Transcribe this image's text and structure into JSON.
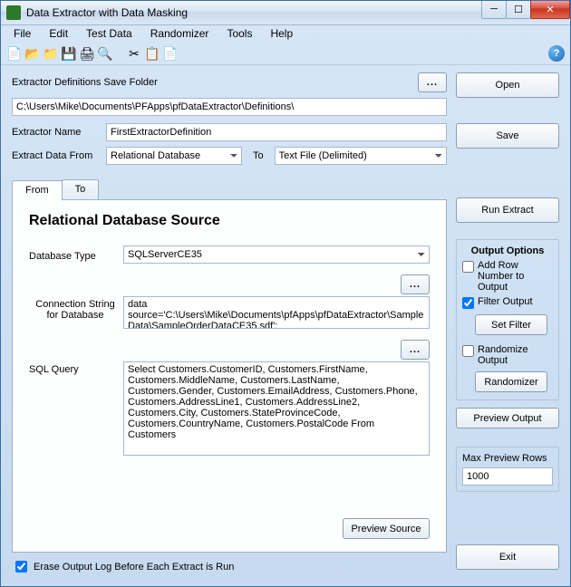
{
  "window": {
    "title": "Data Extractor with Data Masking"
  },
  "menu": [
    "File",
    "Edit",
    "Test Data",
    "Randomizer",
    "Tools",
    "Help"
  ],
  "form": {
    "save_folder_label": "Extractor Definitions Save Folder",
    "save_folder": "C:\\Users\\Mike\\Documents\\PFApps\\pfDataExtractor\\Definitions\\",
    "name_label": "Extractor Name",
    "name": "FirstExtractorDefinition",
    "from_label": "Extract Data From",
    "from_value": "Relational Database",
    "to_label": "To",
    "to_value": "Text File (Delimited)"
  },
  "tabs": {
    "from": "From",
    "to": "To"
  },
  "panel": {
    "title": "Relational Database Source",
    "db_type_label": "Database Type",
    "db_type": "SQLServerCE35",
    "conn_label_1": "Connection String",
    "conn_label_2": "for Database",
    "conn_value": "data source='C:\\Users\\Mike\\Documents\\pfApps\\pfDataExtractor\\SampleData\\SampleOrderDataCE35.sdf';",
    "sql_label": "SQL Query",
    "sql_value": "Select Customers.CustomerID, Customers.FirstName, Customers.MiddleName, Customers.LastName, Customers.Gender, Customers.EmailAddress, Customers.Phone, Customers.AddressLine1, Customers.AddressLine2, Customers.City, Customers.StateProvinceCode, Customers.CountryName, Customers.PostalCode From Customers",
    "preview_source": "Preview Source"
  },
  "buttons": {
    "open": "Open",
    "save": "Save",
    "run": "Run Extract",
    "set_filter": "Set Filter",
    "randomizer": "Randomizer",
    "preview_output": "Preview Output",
    "exit": "Exit"
  },
  "output": {
    "title": "Output Options",
    "add_row": "Add Row Number to Output",
    "filter": "Filter Output",
    "randomize": "Randomize Output"
  },
  "preview": {
    "label": "Max Preview Rows",
    "value": "1000"
  },
  "bottom": {
    "erase_log": "Erase Output Log Before Each Extract is Run"
  }
}
